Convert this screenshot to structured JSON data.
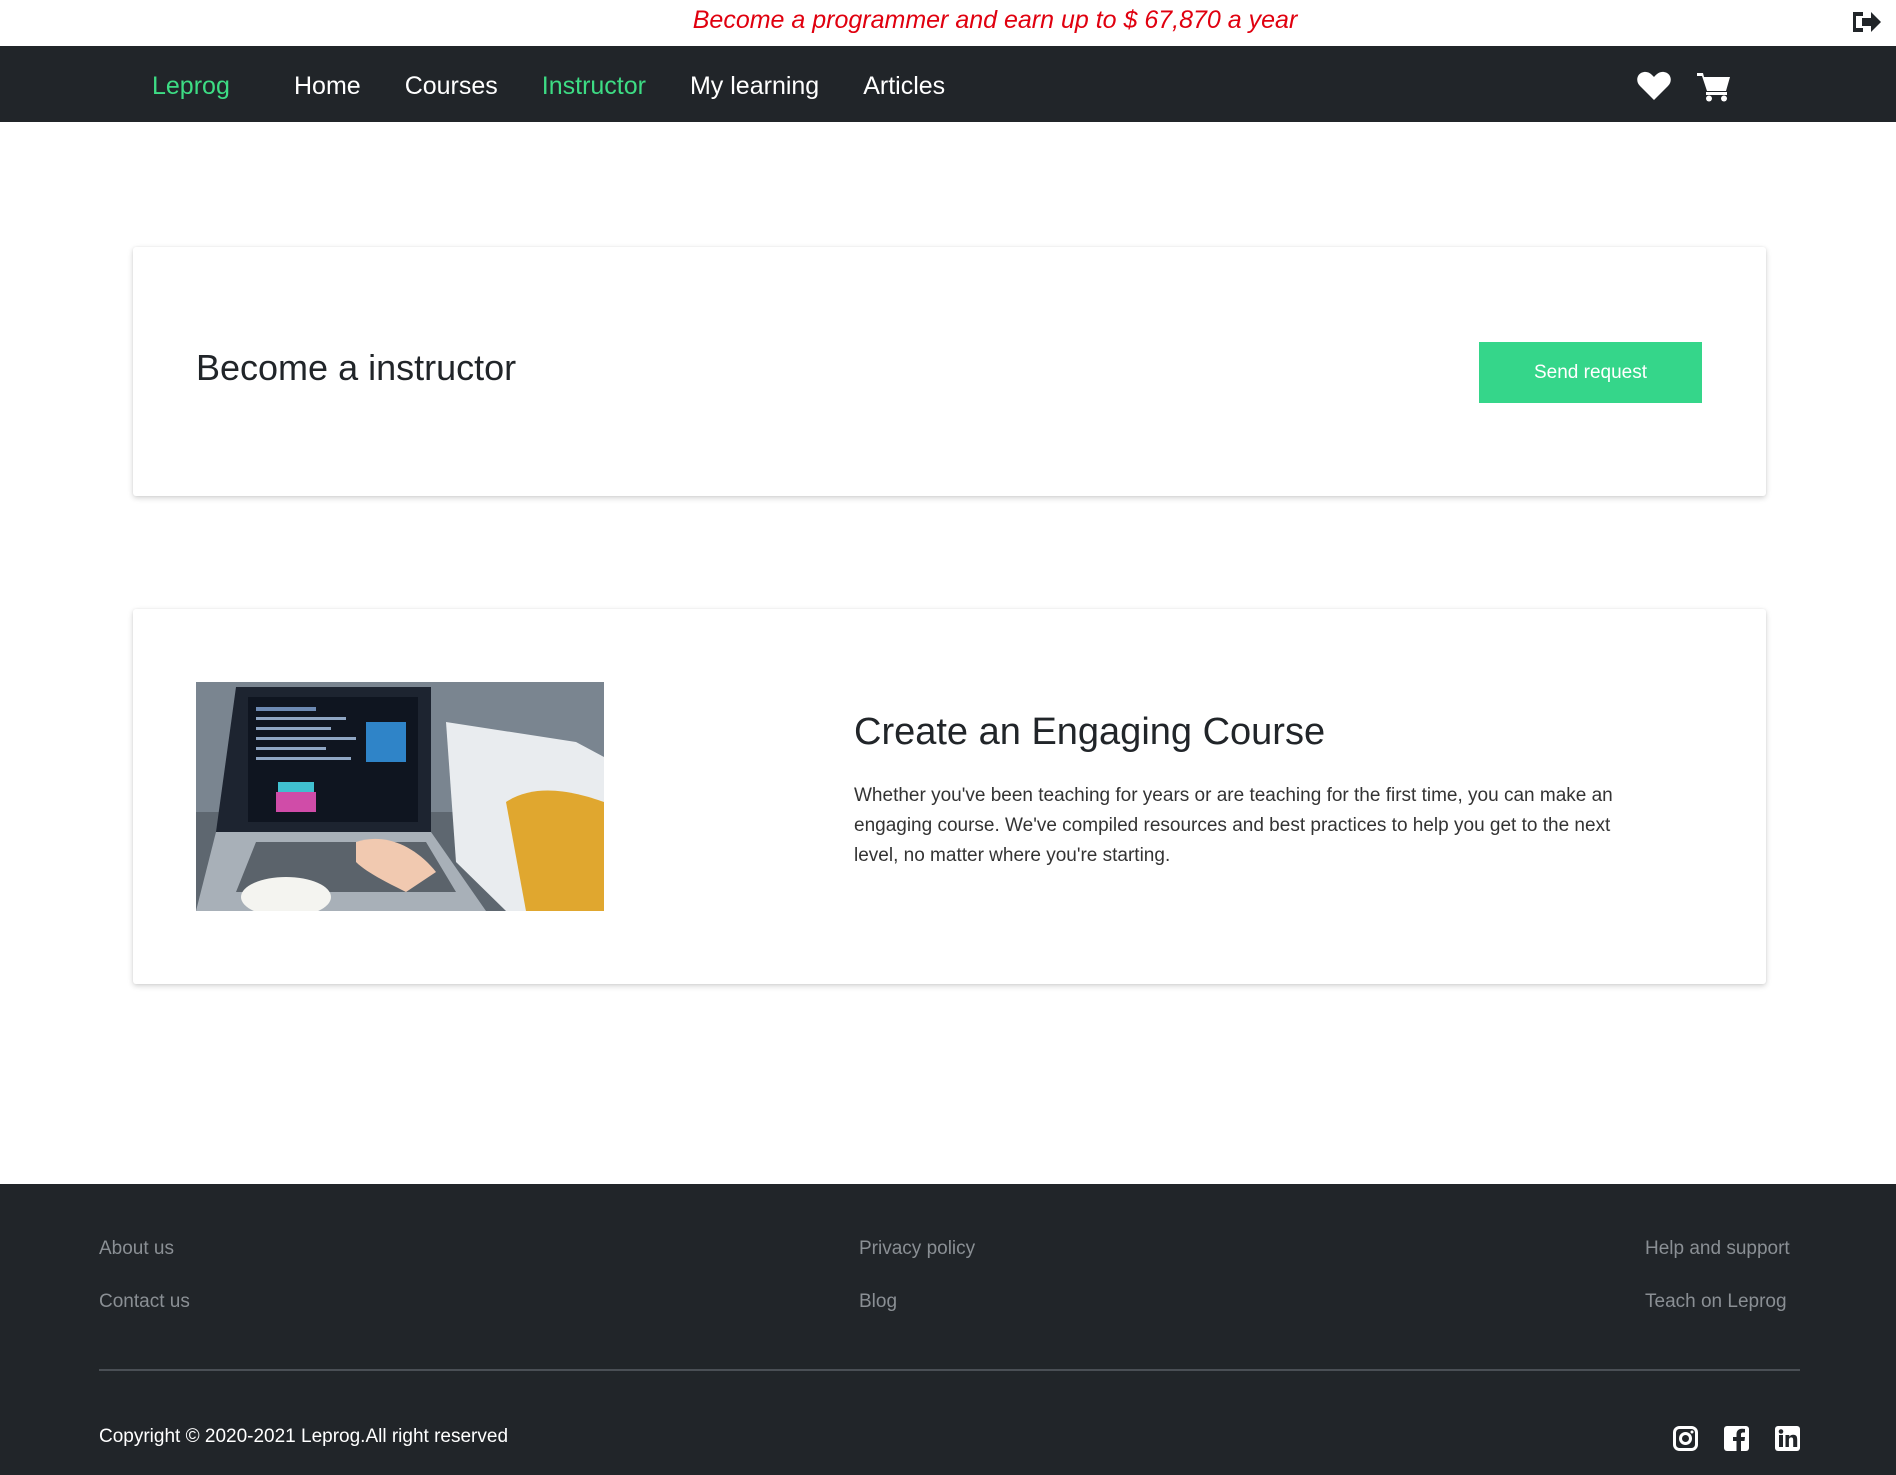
{
  "promo": {
    "text": "Become a programmer and earn up to $ 67,870 a year",
    "color": "#e0000f",
    "logout_icon": "sign-out-icon"
  },
  "navbar": {
    "brand": "Leprog",
    "links": [
      {
        "label": "Home",
        "active": false
      },
      {
        "label": "Courses",
        "active": false
      },
      {
        "label": "Instructor",
        "active": true
      },
      {
        "label": "My learning",
        "active": false
      },
      {
        "label": "Articles",
        "active": false
      }
    ],
    "icons": [
      "heart-icon",
      "cart-icon"
    ],
    "accent_color": "#3ddc84",
    "background": "#212529"
  },
  "instructor_card": {
    "title": "Become a instructor",
    "button_label": "Send request",
    "button_color": "#35d68a"
  },
  "feature_card": {
    "image_description_icon": "laptop-photo",
    "title": "Create an Engaging Course",
    "text": "Whether you've been teaching for years or are teaching for the first time, you can make an engaging course. We've compiled resources and best practices to help you get to the next level, no matter where you're starting."
  },
  "footer": {
    "col1": [
      "About us",
      "Contact us"
    ],
    "col2": [
      "Privacy policy",
      "Blog"
    ],
    "col3": [
      "Help and support",
      "Teach on Leprog"
    ],
    "copyright": "Copyright © 2020-2021 Leprog.All right reserved",
    "social_icons": [
      "instagram-icon",
      "facebook-icon",
      "linkedin-icon"
    ]
  }
}
